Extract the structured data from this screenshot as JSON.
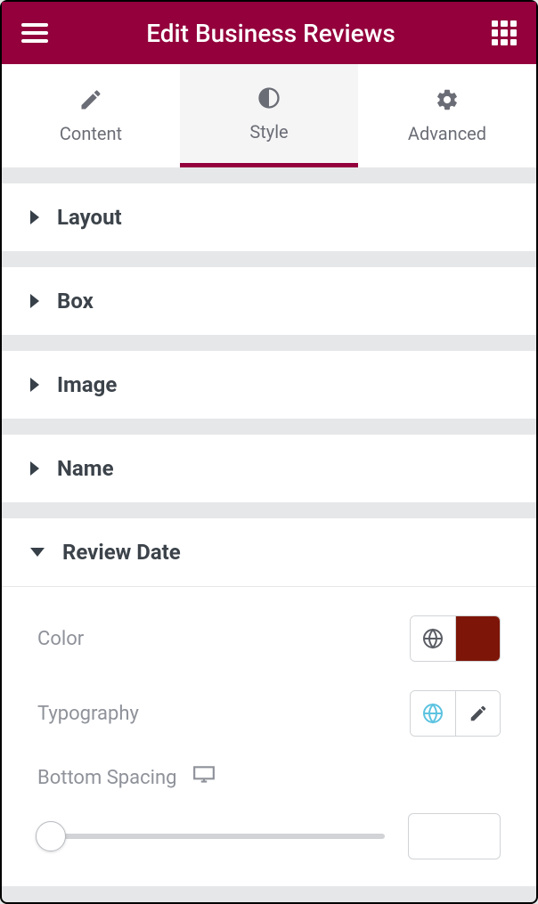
{
  "header": {
    "title": "Edit Business Reviews"
  },
  "tabs": {
    "content": "Content",
    "style": "Style",
    "advanced": "Advanced"
  },
  "sections": {
    "layout": "Layout",
    "box": "Box",
    "image": "Image",
    "name": "Name",
    "reviewDate": "Review Date"
  },
  "controls": {
    "color": {
      "label": "Color",
      "swatch": "#7d1608"
    },
    "typography": {
      "label": "Typography"
    },
    "bottomSpacing": {
      "label": "Bottom Spacing",
      "value": ""
    }
  }
}
